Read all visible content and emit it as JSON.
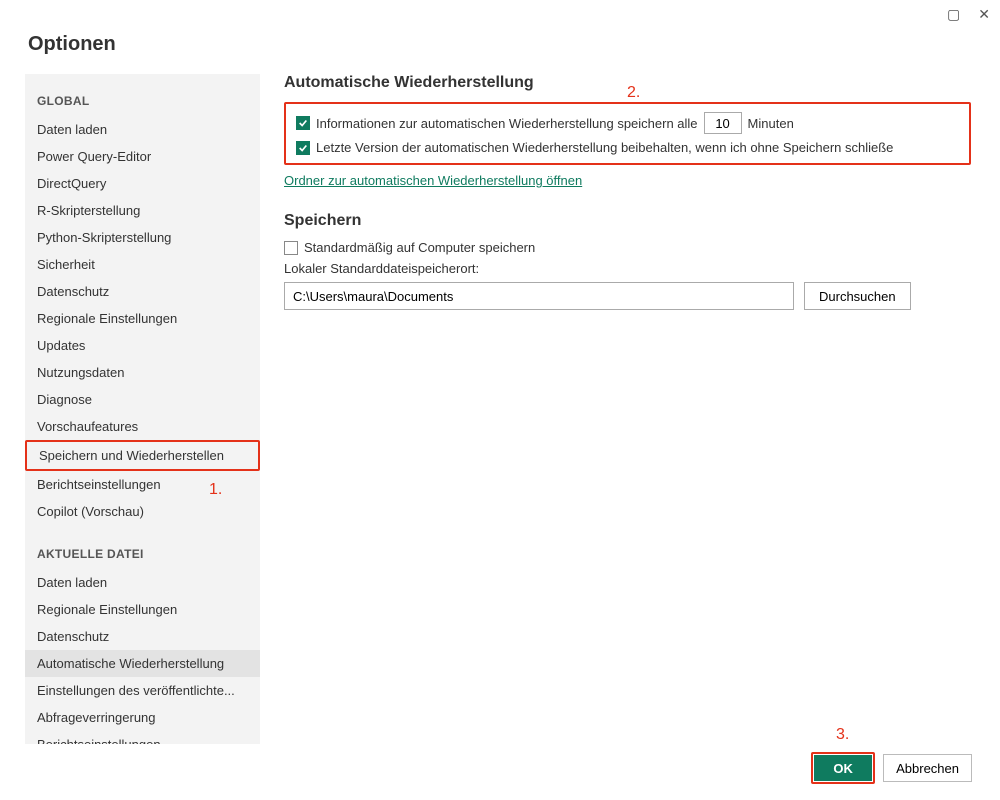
{
  "window": {
    "title": "Optionen",
    "maximize_icon": "▢",
    "close_icon": "✕"
  },
  "annotations": {
    "a1": "1.",
    "a2": "2.",
    "a3": "3."
  },
  "sidebar": {
    "global_header": "GLOBAL",
    "global_items": [
      "Daten laden",
      "Power Query-Editor",
      "DirectQuery",
      "R-Skripterstellung",
      "Python-Skripterstellung",
      "Sicherheit",
      "Datenschutz",
      "Regionale Einstellungen",
      "Updates",
      "Nutzungsdaten",
      "Diagnose",
      "Vorschaufeatures",
      "Speichern und Wiederherstellen",
      "Berichtseinstellungen",
      "Copilot (Vorschau)"
    ],
    "current_header": "AKTUELLE DATEI",
    "current_items": [
      "Daten laden",
      "Regionale Einstellungen",
      "Datenschutz",
      "Automatische Wiederherstellung",
      "Einstellungen des veröffentlichte...",
      "Abfrageverringerung",
      "Berichtseinstellungen"
    ]
  },
  "content": {
    "autorecovery_title": "Automatische Wiederherstellung",
    "cb1_prefix": "Informationen zur automatischen Wiederherstellung speichern alle",
    "cb1_minutes_value": "10",
    "cb1_suffix": "Minuten",
    "cb2_label": "Letzte Version der automatischen Wiederherstellung beibehalten, wenn ich ohne Speichern schließe",
    "open_folder_link": "Ordner zur automatischen Wiederherstellung öffnen",
    "save_title": "Speichern",
    "cb3_label": "Standardmäßig auf Computer speichern",
    "path_label": "Lokaler Standarddateispeicherort:",
    "path_value": "C:\\Users\\maura\\Documents",
    "browse_label": "Durchsuchen"
  },
  "footer": {
    "ok": "OK",
    "cancel": "Abbrechen"
  }
}
